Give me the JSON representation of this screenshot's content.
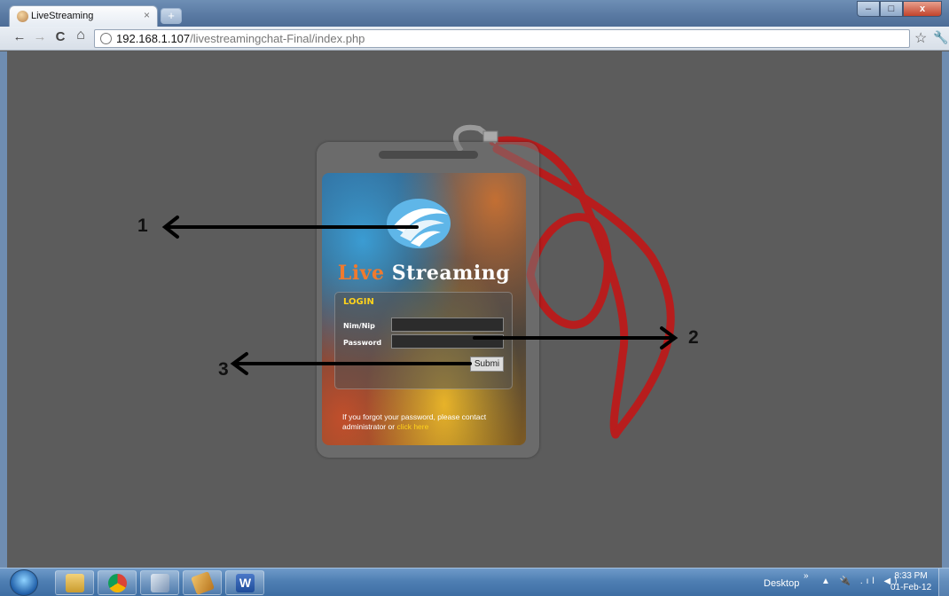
{
  "browser": {
    "tab_title": "LiveStreaming",
    "tab_close": "×",
    "new_tab": "+",
    "url_host": "192.168.1.107",
    "url_path": "/livestreamingchat-Final/index.php",
    "window_buttons": {
      "minimize": "–",
      "maximize": "□",
      "close": "x"
    },
    "nav": {
      "back": "←",
      "forward": "→",
      "reload": "C",
      "home": "⌂"
    },
    "star": "☆",
    "wrench": "🔧"
  },
  "card": {
    "brand_live": "Live",
    "brand_streaming": "Streaming",
    "login_title": "LOGIN",
    "username_label": "Nim/Nip",
    "password_label": "Password",
    "submit_label": "Submi",
    "forgot_text": "If you forgot your password, please contact administrator or",
    "forgot_link": "click here",
    "colors": {
      "live": "#f07a2e",
      "login_title": "#ffd21c",
      "link": "#ffd21c",
      "lanyard": "#b71d1d"
    }
  },
  "annotations": {
    "one": "1",
    "two": "2",
    "three": "3"
  },
  "taskbar": {
    "apps": [
      "start-orb",
      "file-explorer",
      "chrome",
      "paint",
      "winamp",
      "word"
    ],
    "desktop_label": "Desktop",
    "chevron": "»",
    "tray_icons": "▲ 🔌 .ıl ◀)",
    "time": "8:33 PM",
    "date": "01-Feb-12"
  }
}
